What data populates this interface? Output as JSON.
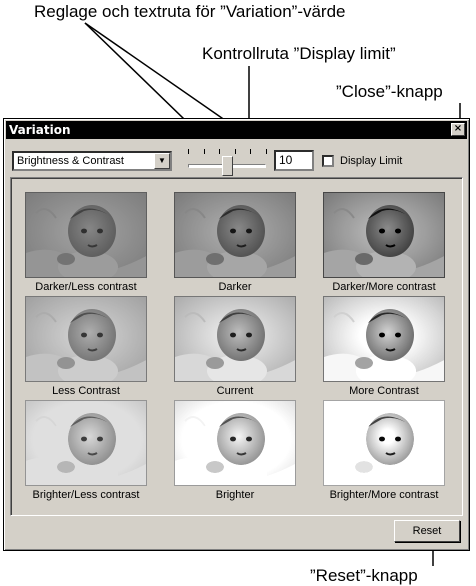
{
  "callouts": {
    "slider_text": "Reglage och textruta för ”Variation”-värde",
    "display_limit": "Kontrollruta ”Display limit”",
    "close": "”Close”-knapp",
    "reset": "”Reset”-knapp"
  },
  "window": {
    "title": "Variation",
    "close_glyph": "×"
  },
  "toolbar": {
    "mode_select": "Brightness & Contrast",
    "slider_value": 10,
    "slider_min": 0,
    "slider_max": 20,
    "value_field": "10",
    "display_limit_label": "Display Limit",
    "display_limit_checked": false
  },
  "thumbnails": [
    {
      "label": "Darker/Less contrast",
      "brightness": 0.72,
      "contrast": 0.75
    },
    {
      "label": "Darker",
      "brightness": 0.72,
      "contrast": 1.0
    },
    {
      "label": "Darker/More contrast",
      "brightness": 0.72,
      "contrast": 1.35
    },
    {
      "label": "Less Contrast",
      "brightness": 1.0,
      "contrast": 0.75
    },
    {
      "label": "Current",
      "brightness": 1.0,
      "contrast": 1.0
    },
    {
      "label": "More Contrast",
      "brightness": 1.0,
      "contrast": 1.35
    },
    {
      "label": "Brighter/Less contrast",
      "brightness": 1.3,
      "contrast": 0.75
    },
    {
      "label": "Brighter",
      "brightness": 1.3,
      "contrast": 1.0
    },
    {
      "label": "Brighter/More contrast",
      "brightness": 1.3,
      "contrast": 1.35
    }
  ],
  "reset_label": "Reset"
}
